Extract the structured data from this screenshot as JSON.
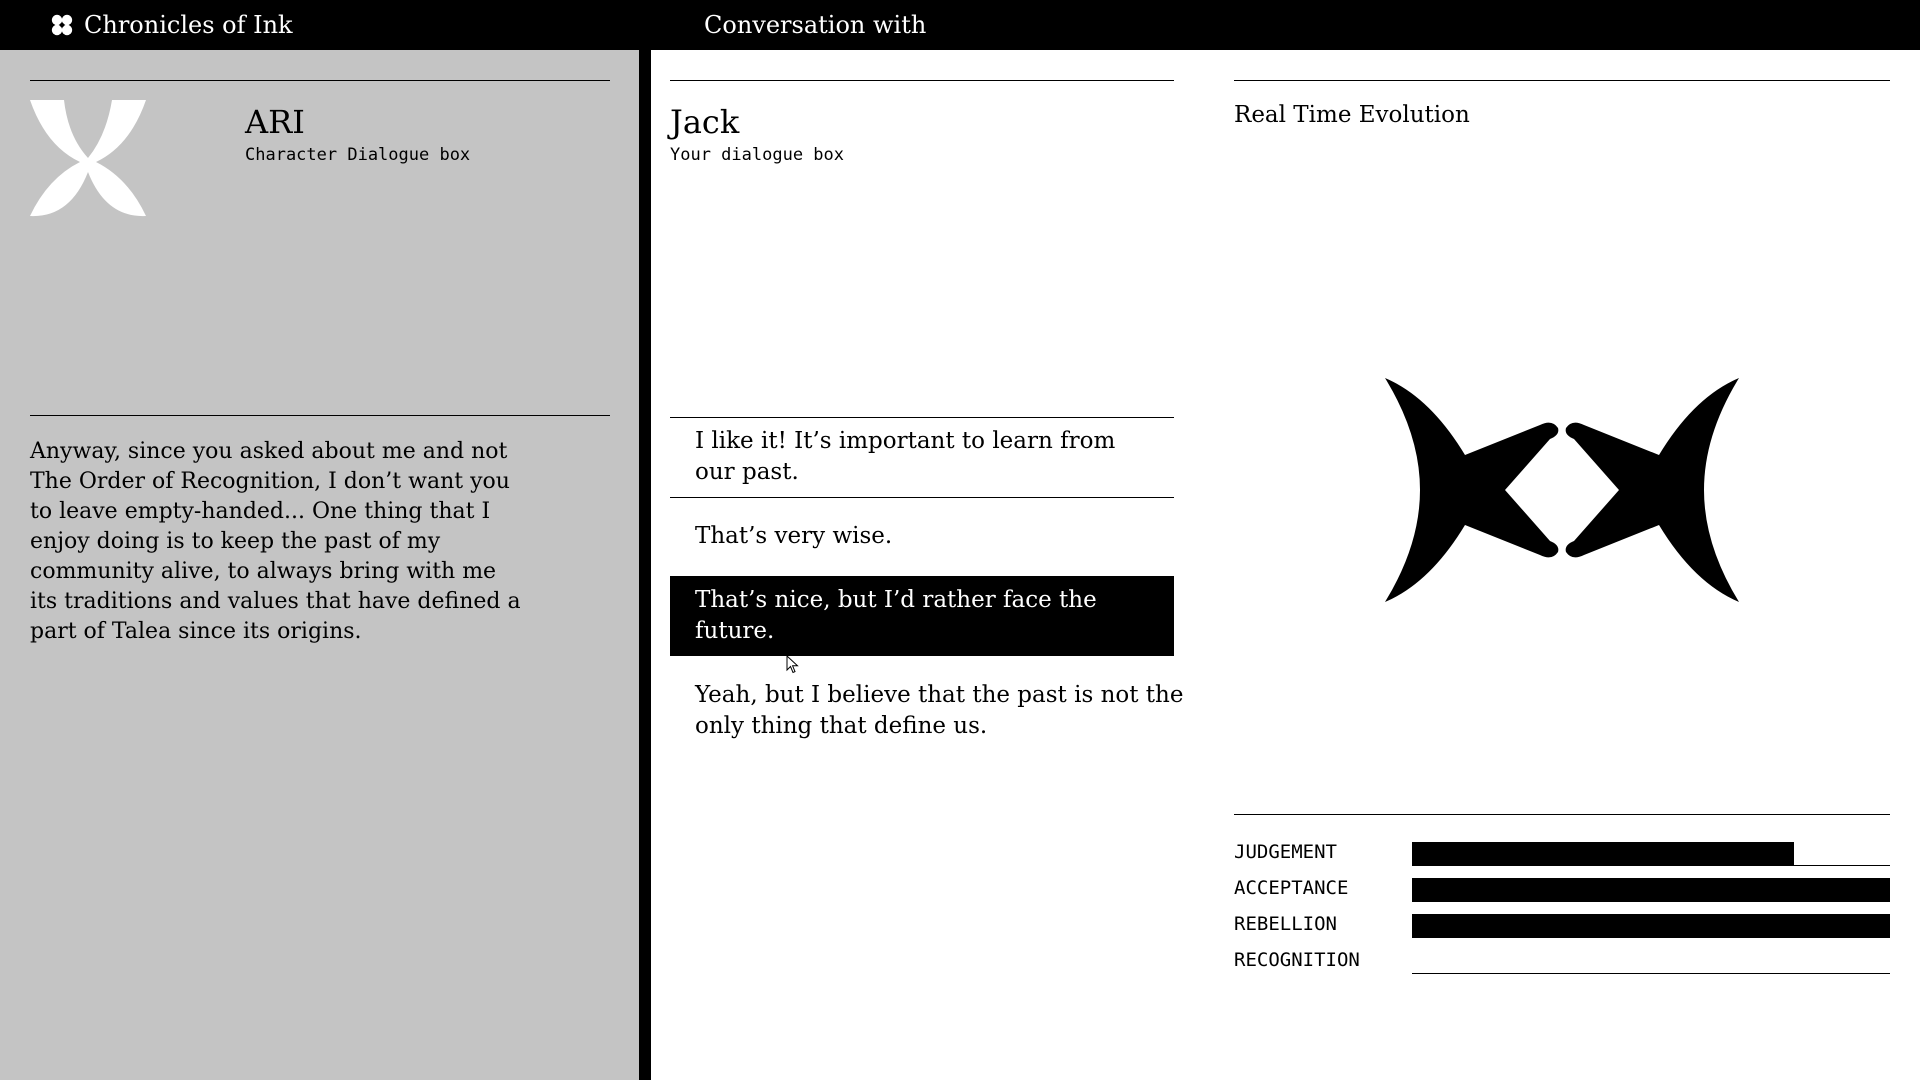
{
  "header": {
    "app_title": "Chronicles of Ink",
    "conversation_title": "Conversation with"
  },
  "character": {
    "name": "ARI",
    "subtitle": "Character Dialogue box",
    "dialogue": "Anyway, since you asked about me and not The Order of Recognition, I don’t want you to leave empty-handed... One thing that I enjoy doing is to keep the past of my community alive, to always bring with me its traditions and values that have defined a part of Talea since its origins."
  },
  "player": {
    "name": "Jack",
    "subtitle": "Your dialogue box",
    "choices": [
      {
        "text": "I like it! It’s important to learn from our past.",
        "selected": false
      },
      {
        "text": "That’s very wise.",
        "selected": false
      },
      {
        "text": "That’s nice, but I’d rather face the future.",
        "selected": true
      },
      {
        "text": "Yeah, but I believe that the past is not the only thing that define us.",
        "selected": false
      }
    ]
  },
  "evolution": {
    "title": "Real Time Evolution",
    "stats": [
      {
        "label": "JUDGEMENT",
        "value": 0.8
      },
      {
        "label": "ACCEPTANCE",
        "value": 1.0
      },
      {
        "label": "REBELLION",
        "value": 1.0
      },
      {
        "label": "RECOGNITION",
        "value": 0.0
      }
    ]
  },
  "colors": {
    "panel_gray": "#c4c4c4",
    "ink": "#000000",
    "paper": "#ffffff"
  },
  "icons": {
    "app_logo": "clover-icon",
    "character_avatar": "ari-emblem-icon",
    "evolution_symbol": "ink-symbol-icon",
    "pointer": "mouse-cursor-icon"
  }
}
